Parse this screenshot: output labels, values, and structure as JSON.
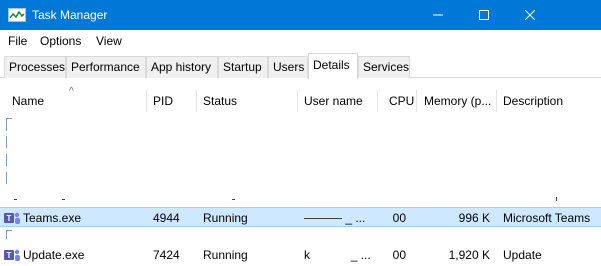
{
  "window": {
    "title": "Task Manager"
  },
  "menu": [
    "File",
    "Options",
    "View"
  ],
  "tabs": [
    {
      "label": "Processes"
    },
    {
      "label": "Performance"
    },
    {
      "label": "App history"
    },
    {
      "label": "Startup"
    },
    {
      "label": "Users"
    },
    {
      "label": "Details"
    },
    {
      "label": "Services"
    }
  ],
  "active_tab": "Details",
  "columns": {
    "name": "Name",
    "pid": "PID",
    "status": "Status",
    "username": "User name",
    "cpu": "CPU",
    "memory": "Memory (p...",
    "description": "Description"
  },
  "rows": [
    {
      "name": "Teams.exe",
      "pid": "4944",
      "status": "Running",
      "username_suffix": "_ ...",
      "cpu": "00",
      "memory": "996 K",
      "description": "Microsoft Teams",
      "selected": true
    },
    {
      "name": "Update.exe",
      "pid": "7424",
      "status": "Running",
      "username_prefix": "k",
      "username_suffix": "_ ...",
      "cpu": "00",
      "memory": "1,920 K",
      "description": "Update",
      "selected": false
    }
  ],
  "colors": {
    "titlebar": "#0078d7",
    "selection": "#cde8ff",
    "teams_icon": "#5558af"
  },
  "icons": {
    "app": "task-manager-icon",
    "process": "teams-icon"
  }
}
